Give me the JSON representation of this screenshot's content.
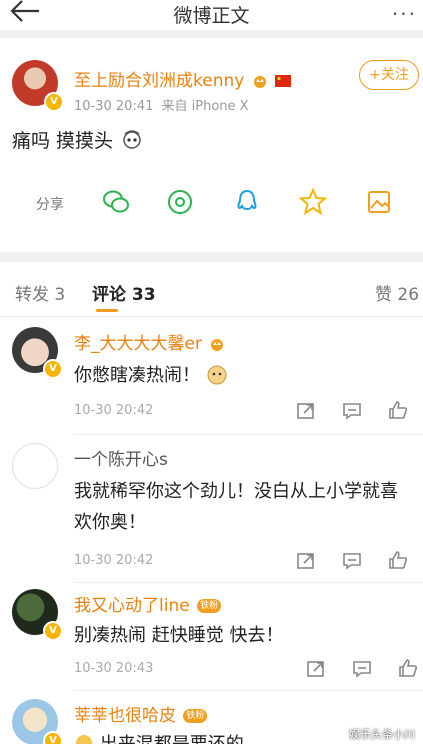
{
  "header": {
    "title": "微博正文",
    "more_label": "···"
  },
  "post": {
    "author": "至上励合刘洲成kenny",
    "time": "10-30 20:41",
    "source": "来自 iPhone X",
    "follow_label": "+关注",
    "text": "痛吗 摸摸头",
    "share_label": "分享"
  },
  "tabs": {
    "reposts": "转发 3",
    "comments": "评论 33",
    "likes": "赞 26"
  },
  "comments": [
    {
      "name": "李_大大大大馨er",
      "text": "你憋瞎凑热闹！",
      "time": "10-30 20:42"
    },
    {
      "name": "一个陈开心s",
      "text": "我就稀罕你这个劲儿！没白从上小学就喜欢你奥！",
      "time": "10-30 20:42"
    },
    {
      "name": "我又心动了line",
      "badge": "铁粉",
      "text": "别凑热闹 赶快睡觉 快去！",
      "time": "10-30 20:43"
    },
    {
      "name": "莘莘也很哈皮",
      "badge": "铁粉",
      "text": "出来混都是要还的"
    }
  ],
  "watermark": "娱乐头条小川",
  "colors": {
    "accent": "#f29c1d",
    "name": "#e8820f",
    "verified": "#f7b500"
  }
}
